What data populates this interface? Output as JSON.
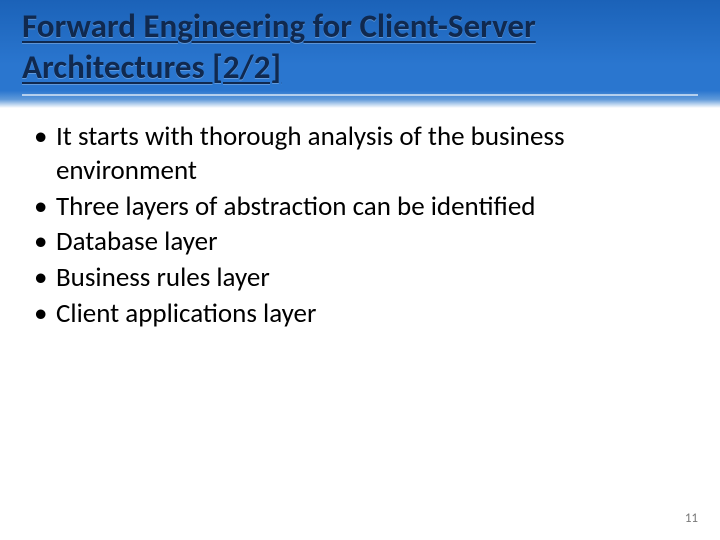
{
  "slide": {
    "title": "Forward Engineering for Client-Server Architectures [2/2]",
    "bullets": [
      "It starts with thorough analysis of the business environment",
      "Three layers of abstraction can be identified",
      "Database layer",
      "Business rules layer",
      "Client applications layer"
    ],
    "page_number": "11"
  }
}
